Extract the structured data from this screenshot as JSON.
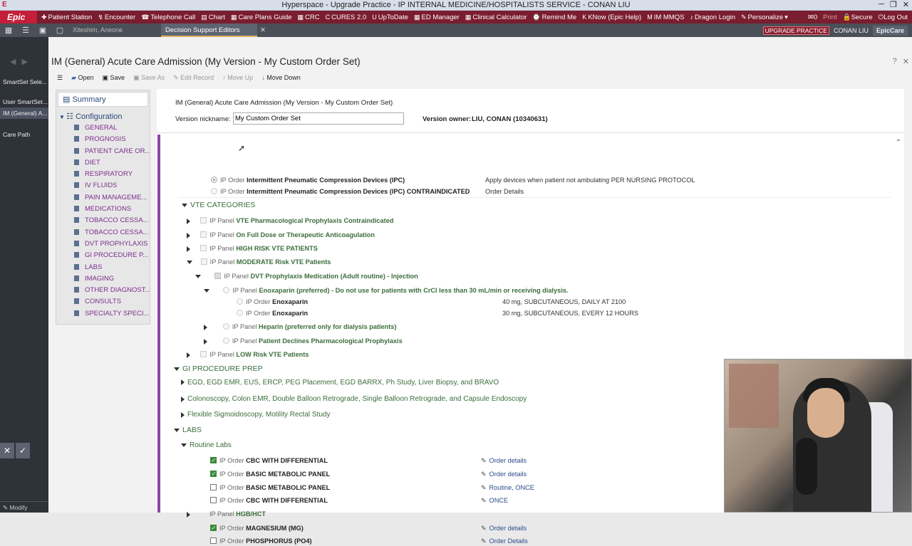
{
  "window": {
    "title": "Hyperspace - Upgrade Practice - IP INTERNAL MEDICINE/HOSPITALISTS  SERVICE - CONAN LIU",
    "app_letter": "E"
  },
  "topbar": {
    "logo": "Epic",
    "items": [
      {
        "icon": "✚",
        "label": "Patient Station"
      },
      {
        "icon": "↯",
        "label": "Encounter"
      },
      {
        "icon": "☎",
        "label": "Telephone Call"
      },
      {
        "icon": "▤",
        "label": "Chart"
      },
      {
        "icon": "▦",
        "label": "Care Plans Guide"
      },
      {
        "icon": "▦",
        "label": "CRC"
      },
      {
        "icon": "C",
        "label": "CURES 2.0"
      },
      {
        "icon": "U",
        "label": "UpToDate"
      },
      {
        "icon": "▦",
        "label": "ED Manager"
      },
      {
        "icon": "▦",
        "label": "Clinical Calculator"
      },
      {
        "icon": "⌚",
        "label": "Remind Me"
      },
      {
        "icon": "K",
        "label": "KNow (Epic Help)"
      },
      {
        "icon": "M",
        "label": "IM MMQS"
      },
      {
        "icon": "♪",
        "label": "Dragon Login"
      },
      {
        "icon": "✎",
        "label": "Personalize"
      }
    ],
    "right": {
      "print": "Print",
      "secure": "Secure",
      "logout": "Log Out",
      "mail": "✉0"
    }
  },
  "tabbar": {
    "patient_tab": "Xiteshim, Aneone",
    "active_tab": "Decision Support Editors",
    "upgrade": "UPGRADE PRACTICE",
    "user": "CONAN LIU",
    "product": "EpicCare"
  },
  "leftcol": {
    "items": [
      "SmartSet Sele...",
      "User SmartSet...",
      "IM (General) A...",
      "Care Path"
    ],
    "bottom": "Modify"
  },
  "main": {
    "title": "IM (General) Acute Care Admission (My Version - My Custom Order Set)",
    "toolbar": {
      "open": "Open",
      "save": "Save",
      "save_as": "Save As",
      "edit": "Edit Record",
      "up": "Move Up",
      "down": "Move Down"
    }
  },
  "sidenav": {
    "summary": "Summary",
    "config": "Configuration",
    "items": [
      "GENERAL",
      "PROGNOSIS",
      "PATIENT CARE OR...",
      "DIET",
      "RESPIRATORY",
      "IV FLUIDS",
      "PAIN MANAGEME...",
      "MEDICATIONS",
      "TOBACCO CESSA...",
      "TOBACCO CESSA...",
      "DVT PROPHYLAXIS",
      "GI PROCEDURE P...",
      "LABS",
      "IMAGING",
      "OTHER DIAGNOST...",
      "CONSULTS",
      "SPECIALTY SPECI..."
    ]
  },
  "header": {
    "title": "IM (General) Acute Care Admission (My Version - My Custom Order Set)",
    "nick_label": "Version nickname:",
    "nick_value": "My Custom Order Set",
    "owner_label": "Version owner:",
    "owner_value": "LIU, CONAN (10340631)"
  },
  "rows": {
    "ipc1": {
      "type": "IP Order",
      "name": "Intermittent Pneumatic Compression Devices (IPC)",
      "detail": "Apply devices when patient not ambulating PER NURSING PROTOCOL"
    },
    "ipc2": {
      "type": "IP Order",
      "name": "Intermittent Pneumatic Compression Devices (IPC) CONTRAINDICATED",
      "detail": "Order Details"
    },
    "vte_cat": "VTE CATEGORIES",
    "vte1": {
      "type": "IP Panel",
      "name": "VTE Pharmacological Prophylaxis Contraindicated"
    },
    "vte2": {
      "type": "IP Panel",
      "name": "On Full Dose or Therapeutic Anticoagulation"
    },
    "vte3": {
      "type": "IP Panel",
      "name": "HIGH RISK VTE PATIENTS"
    },
    "vte4": {
      "type": "IP Panel",
      "name": "MODERATE Risk VTE Patients"
    },
    "dvt": {
      "type": "IP Panel",
      "name": "DVT Prophylaxis Medication (Adult routine) - Injection"
    },
    "enox_panel": {
      "type": "IP Panel",
      "name": "Enoxaparin (preferred) - Do not use for patients with CrCl less than 30 mL/min or receiving dialysis."
    },
    "enox1": {
      "type": "IP Order",
      "name": "Enoxaparin",
      "detail": "40 mg, SUBCUTANEOUS, DAILY AT 2100"
    },
    "enox2": {
      "type": "IP Order",
      "name": "Enoxaparin",
      "detail": "30 mg, SUBCUTANEOUS, EVERY 12 HOURS"
    },
    "heparin": {
      "type": "IP Panel",
      "name": "Heparin (preferred only for dialysis patients)"
    },
    "declines": {
      "type": "IP Panel",
      "name": "Patient Declines Pharmacological Prophylaxis"
    },
    "low": {
      "type": "IP Panel",
      "name": "LOW Risk VTE Patients"
    },
    "gi_sec": "GI PROCEDURE PREP",
    "gi1": "EGD, EGD EMR, EUS, ERCP, PEG Placement, EGD BARRX, Ph Study, Liver Biopsy, and BRAVO",
    "gi2": "Colonoscopy, Colon EMR, Double Balloon Retrograde, Single Balloon Retrograde, and Capsule Endoscopy",
    "gi3": "Flexible Sigmoidoscopy, Motility Rectal Study",
    "labs_sec": "LABS",
    "routine": "Routine Labs",
    "lab1": {
      "type": "IP Order",
      "name": "CBC WITH DIFFERENTIAL",
      "detail": "Order details"
    },
    "lab2": {
      "type": "IP Order",
      "name": "BASIC METABOLIC PANEL",
      "detail": "Order details"
    },
    "lab3": {
      "type": "IP Order",
      "name": "BASIC METABOLIC PANEL",
      "detail": "Routine, ONCE"
    },
    "lab4": {
      "type": "IP Order",
      "name": "CBC WITH DIFFERENTIAL",
      "detail": "ONCE"
    },
    "lab5": {
      "type": "IP Panel",
      "name": "HGB/HCT"
    },
    "lab6": {
      "type": "IP Order",
      "name": "MAGNESIUM (MG)",
      "detail": "Order details"
    },
    "lab7": {
      "type": "IP Order",
      "name": "PHOSPHORUS (PO4)",
      "detail": "Order Details"
    }
  }
}
